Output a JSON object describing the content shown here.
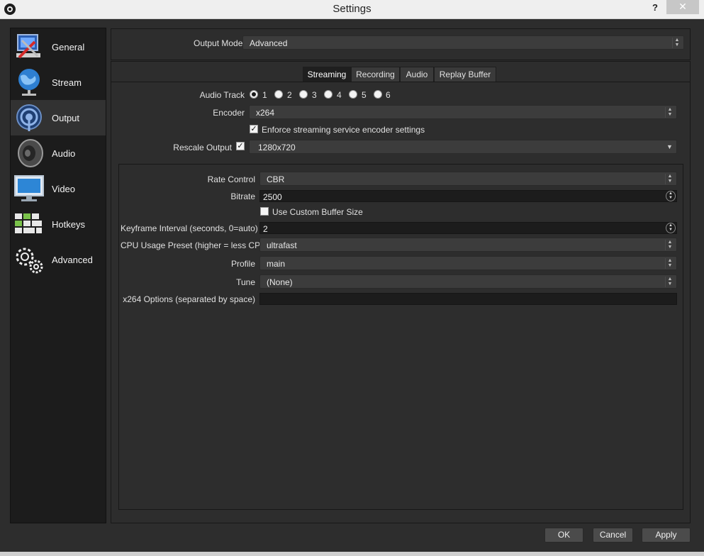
{
  "window": {
    "title": "Settings",
    "help": "?",
    "close": "✕"
  },
  "sidebar": {
    "items": [
      {
        "label": "General",
        "icon": "general-icon"
      },
      {
        "label": "Stream",
        "icon": "globe-icon"
      },
      {
        "label": "Output",
        "icon": "broadcast-icon",
        "selected": true
      },
      {
        "label": "Audio",
        "icon": "speaker-icon"
      },
      {
        "label": "Video",
        "icon": "monitor-icon"
      },
      {
        "label": "Hotkeys",
        "icon": "keyboard-icon"
      },
      {
        "label": "Advanced",
        "icon": "gears-icon"
      }
    ]
  },
  "output_mode": {
    "label": "Output Mode",
    "value": "Advanced"
  },
  "tabs": [
    {
      "label": "Streaming",
      "active": true
    },
    {
      "label": "Recording"
    },
    {
      "label": "Audio"
    },
    {
      "label": "Replay Buffer"
    }
  ],
  "streaming": {
    "audio_track": {
      "label": "Audio Track",
      "options": [
        "1",
        "2",
        "3",
        "4",
        "5",
        "6"
      ],
      "selected": "1"
    },
    "encoder": {
      "label": "Encoder",
      "value": "x264"
    },
    "enforce": {
      "label": "Enforce streaming service encoder settings",
      "checked": true
    },
    "rescale": {
      "label": "Rescale Output",
      "checked": true,
      "value": "1280x720"
    }
  },
  "encoder_settings": {
    "rate_control": {
      "label": "Rate Control",
      "value": "CBR"
    },
    "bitrate": {
      "label": "Bitrate",
      "value": "2500"
    },
    "custom_buffer": {
      "label": "Use Custom Buffer Size",
      "checked": false
    },
    "keyframe": {
      "label": "Keyframe Interval (seconds, 0=auto)",
      "value": "2"
    },
    "cpu_preset": {
      "label": "CPU Usage Preset (higher = less CPU)",
      "value": "ultrafast"
    },
    "profile": {
      "label": "Profile",
      "value": "main"
    },
    "tune": {
      "label": "Tune",
      "value": "(None)"
    },
    "x264_options": {
      "label": "x264 Options (separated by space)",
      "value": ""
    }
  },
  "buttons": {
    "ok": "OK",
    "cancel": "Cancel",
    "apply": "Apply"
  }
}
